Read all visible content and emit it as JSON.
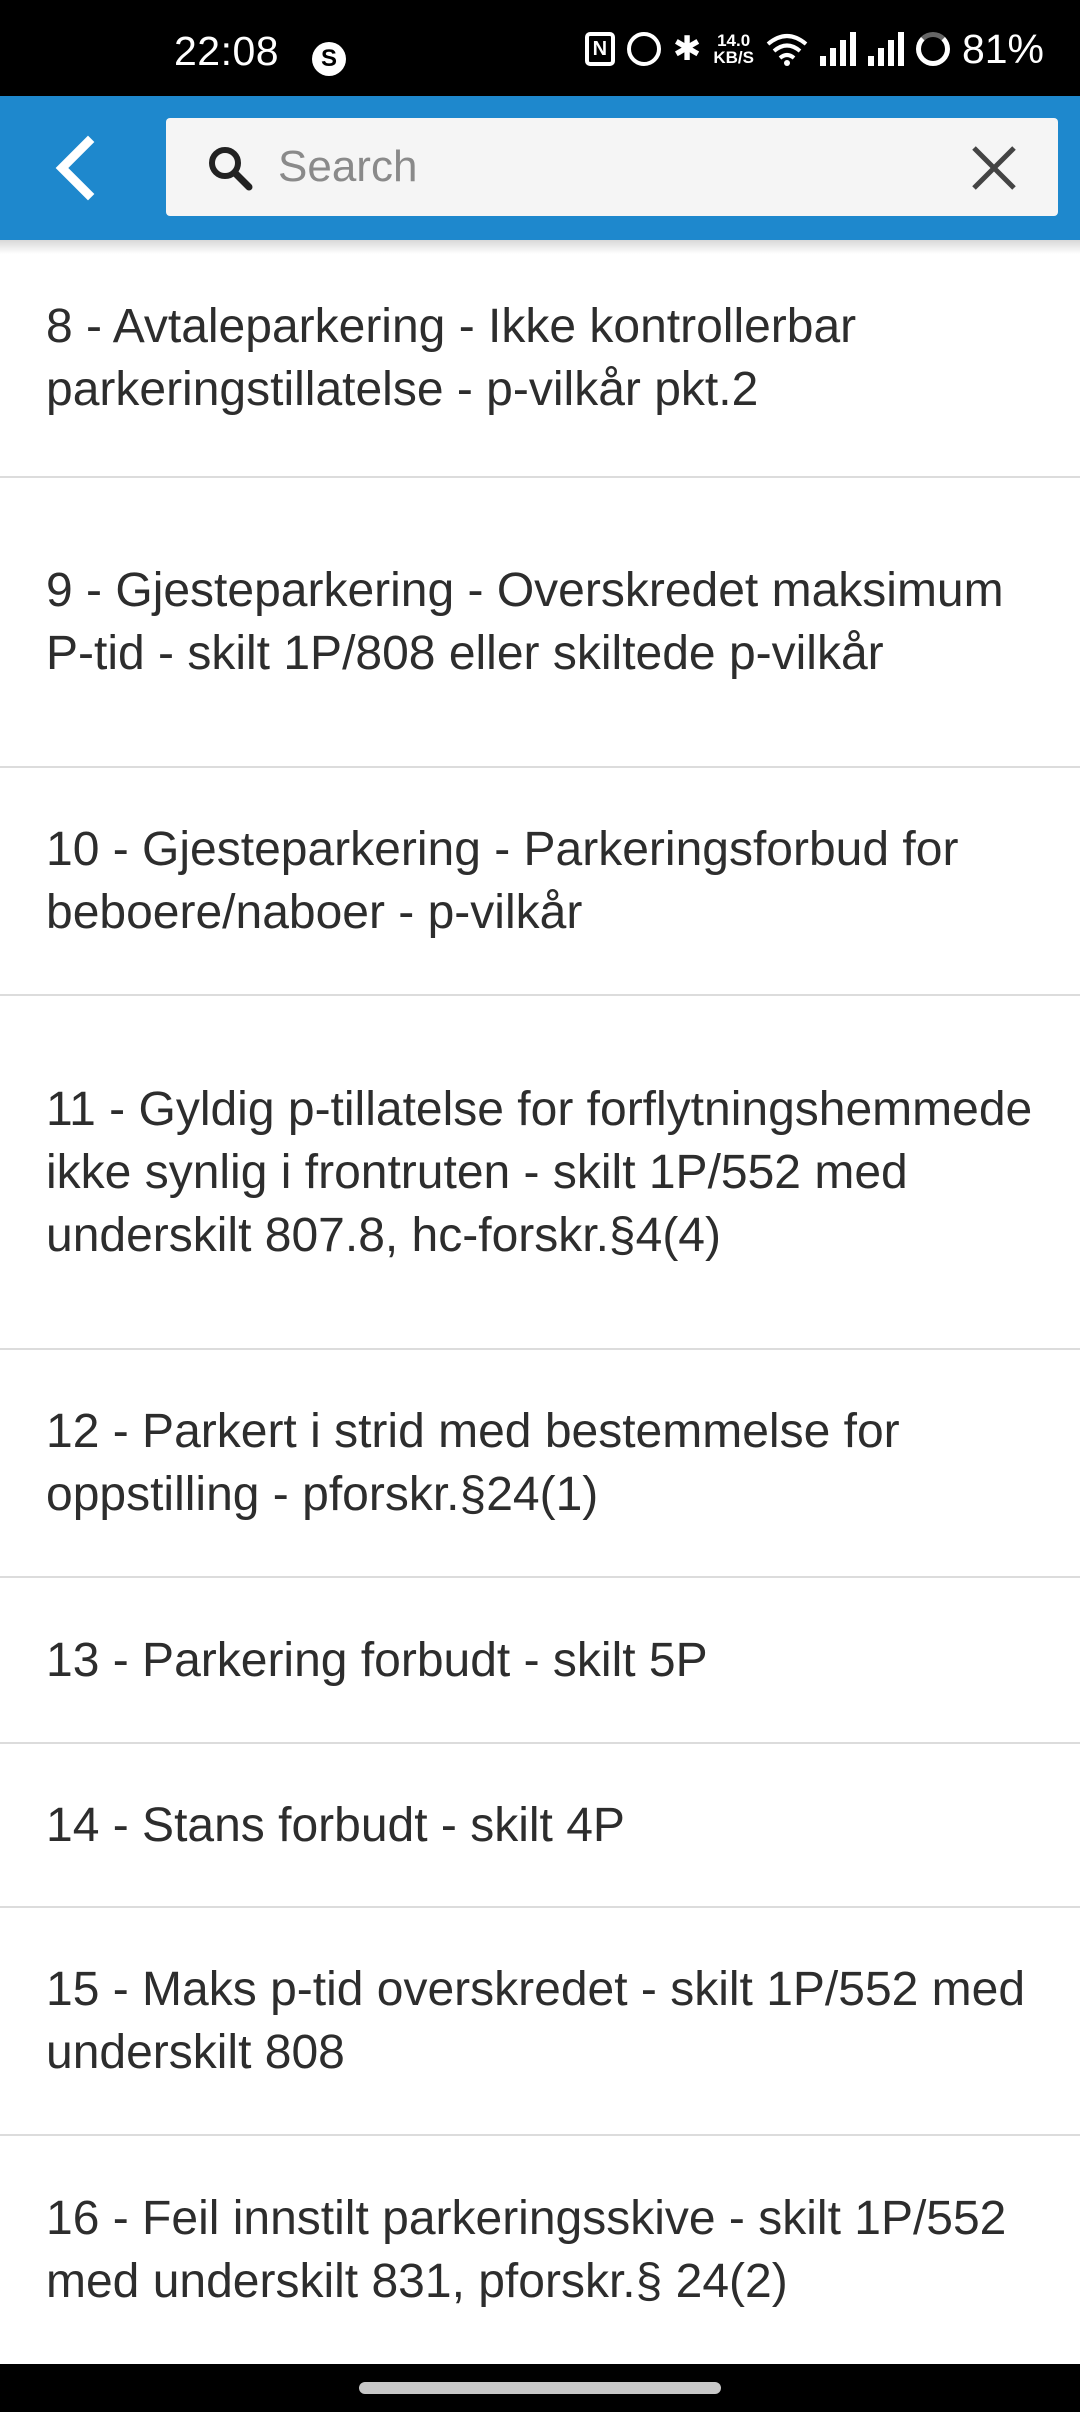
{
  "status_bar": {
    "time": "22:08",
    "left_icon": "s-circle-icon",
    "net_speed_value": "14.0",
    "net_speed_unit": "KB/S",
    "battery": "81%"
  },
  "app_bar": {
    "search": {
      "placeholder": "Search",
      "value": ""
    },
    "accent_color": "#1e88cd"
  },
  "list": {
    "items": [
      {
        "label": "8 - Avtaleparkering - Ikke kontrollerbar parkeringstillatelse - p-vilkår pkt.2"
      },
      {
        "label": "9 - Gjesteparkering - Overskredet maksimum P-tid - skilt 1P/808 eller skiltede p-vilkår"
      },
      {
        "label": "10 - Gjesteparkering - Parkeringsforbud for beboere/naboer - p-vilkår"
      },
      {
        "label": "11 - Gyldig p-tillatelse for forflytningshemmede ikke synlig i frontruten - skilt 1P/552 med underskilt 807.8, hc-forskr.§4(4)"
      },
      {
        "label": "12 - Parkert i strid med bestemmelse for oppstilling - pforskr.§24(1)"
      },
      {
        "label": "13 - Parkering forbudt - skilt 5P"
      },
      {
        "label": "14 - Stans forbudt - skilt 4P"
      },
      {
        "label": "15 - Maks p-tid overskredet - skilt 1P/552 med underskilt 808"
      },
      {
        "label": "16 - Feil innstilt parkeringsskive - skilt 1P/552 med underskilt 831, pforskr.§ 24(2)"
      }
    ]
  }
}
